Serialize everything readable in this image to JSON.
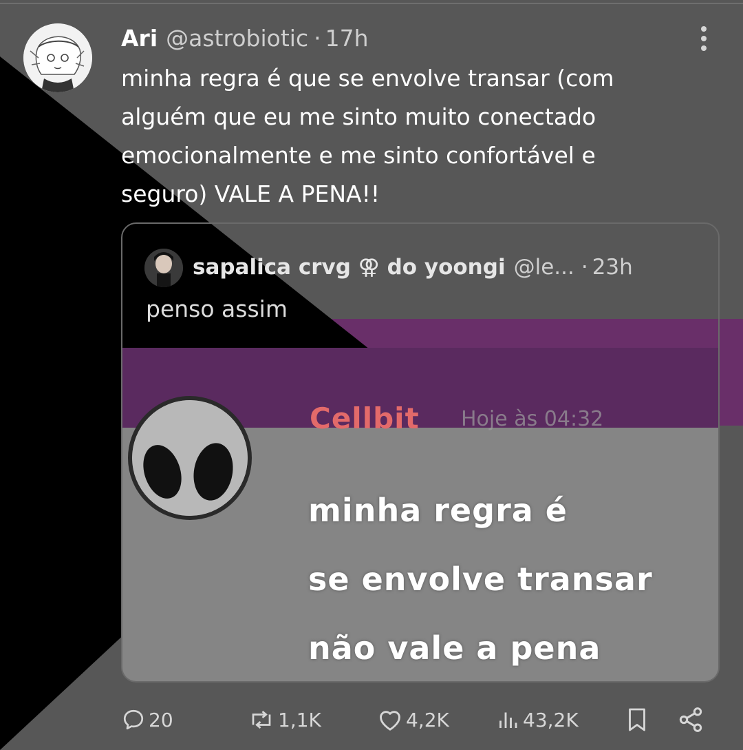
{
  "tweet": {
    "author_name": "Ari",
    "handle": "@astrobiotic",
    "separator": "·",
    "time": "17h",
    "text_lines": [
      "minha regra é que se envolve transar (com",
      "alguém que eu me sinto muito conectado",
      "emocionalmente e me sinto confortável e",
      "seguro) VALE A PENA!!"
    ]
  },
  "quote": {
    "author_name": "sapalica crvg ⚢ do yoongi",
    "handle": "@le...",
    "separator": "·",
    "time": "23h",
    "text": "penso assim",
    "media": {
      "name": "Cellbit",
      "stamp": "Hoje às 04:32",
      "lines": [
        "minha regra é",
        "se envolve transar",
        "não vale a pena"
      ]
    }
  },
  "actions": {
    "replies": "20",
    "reposts": "1,1K",
    "likes": "4,2K",
    "views": "43,2K"
  },
  "icons": [
    "more-options-icon",
    "reply-icon",
    "repost-icon",
    "like-icon",
    "views-icon",
    "bookmark-icon",
    "share-icon"
  ],
  "colors": {
    "background": "#575757",
    "flag_black": "#000000",
    "flag_purple": "#800080",
    "text": "#ffffff",
    "muted_text": "#cfcfcf",
    "media_name": "#e36a6a"
  }
}
